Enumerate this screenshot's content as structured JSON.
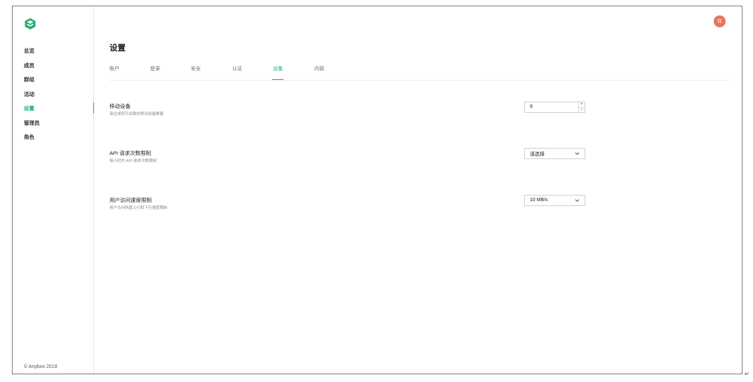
{
  "brand": {
    "accent": "#1dae6c",
    "avatar_color": "#e4765a"
  },
  "sidebar": {
    "items": [
      {
        "label": "总览"
      },
      {
        "label": "成员"
      },
      {
        "label": "群组"
      },
      {
        "label": "活动"
      },
      {
        "label": "设置",
        "active": true
      },
      {
        "label": "管理员"
      },
      {
        "label": "角色"
      }
    ],
    "copyright": "© Anybox 2018"
  },
  "header": {
    "avatar_initial": "R"
  },
  "page": {
    "title": "设置"
  },
  "tabs": [
    {
      "label": "账户"
    },
    {
      "label": "登录"
    },
    {
      "label": "安全"
    },
    {
      "label": "认证"
    },
    {
      "label": "设备",
      "active": true
    },
    {
      "label": "内容"
    }
  ],
  "settings": {
    "mobile_devices": {
      "title": "移动设备",
      "description": "每位成员可关联的移动设备数量",
      "value": "9",
      "increment_icon": "plus-icon",
      "decrement_icon": "minus-icon"
    },
    "api_limit": {
      "title": "API 请求次数限制",
      "description": "每小时内 API 请求次数限制",
      "selected": "请选择",
      "icon": "chevron-down-icon"
    },
    "speed_limit": {
      "title": "用户访问速度限制",
      "description": "用户访问网盘上行和下行速度限制",
      "selected": "10 MB/s",
      "icon": "chevron-down-icon"
    }
  },
  "corner_mark": "↵"
}
